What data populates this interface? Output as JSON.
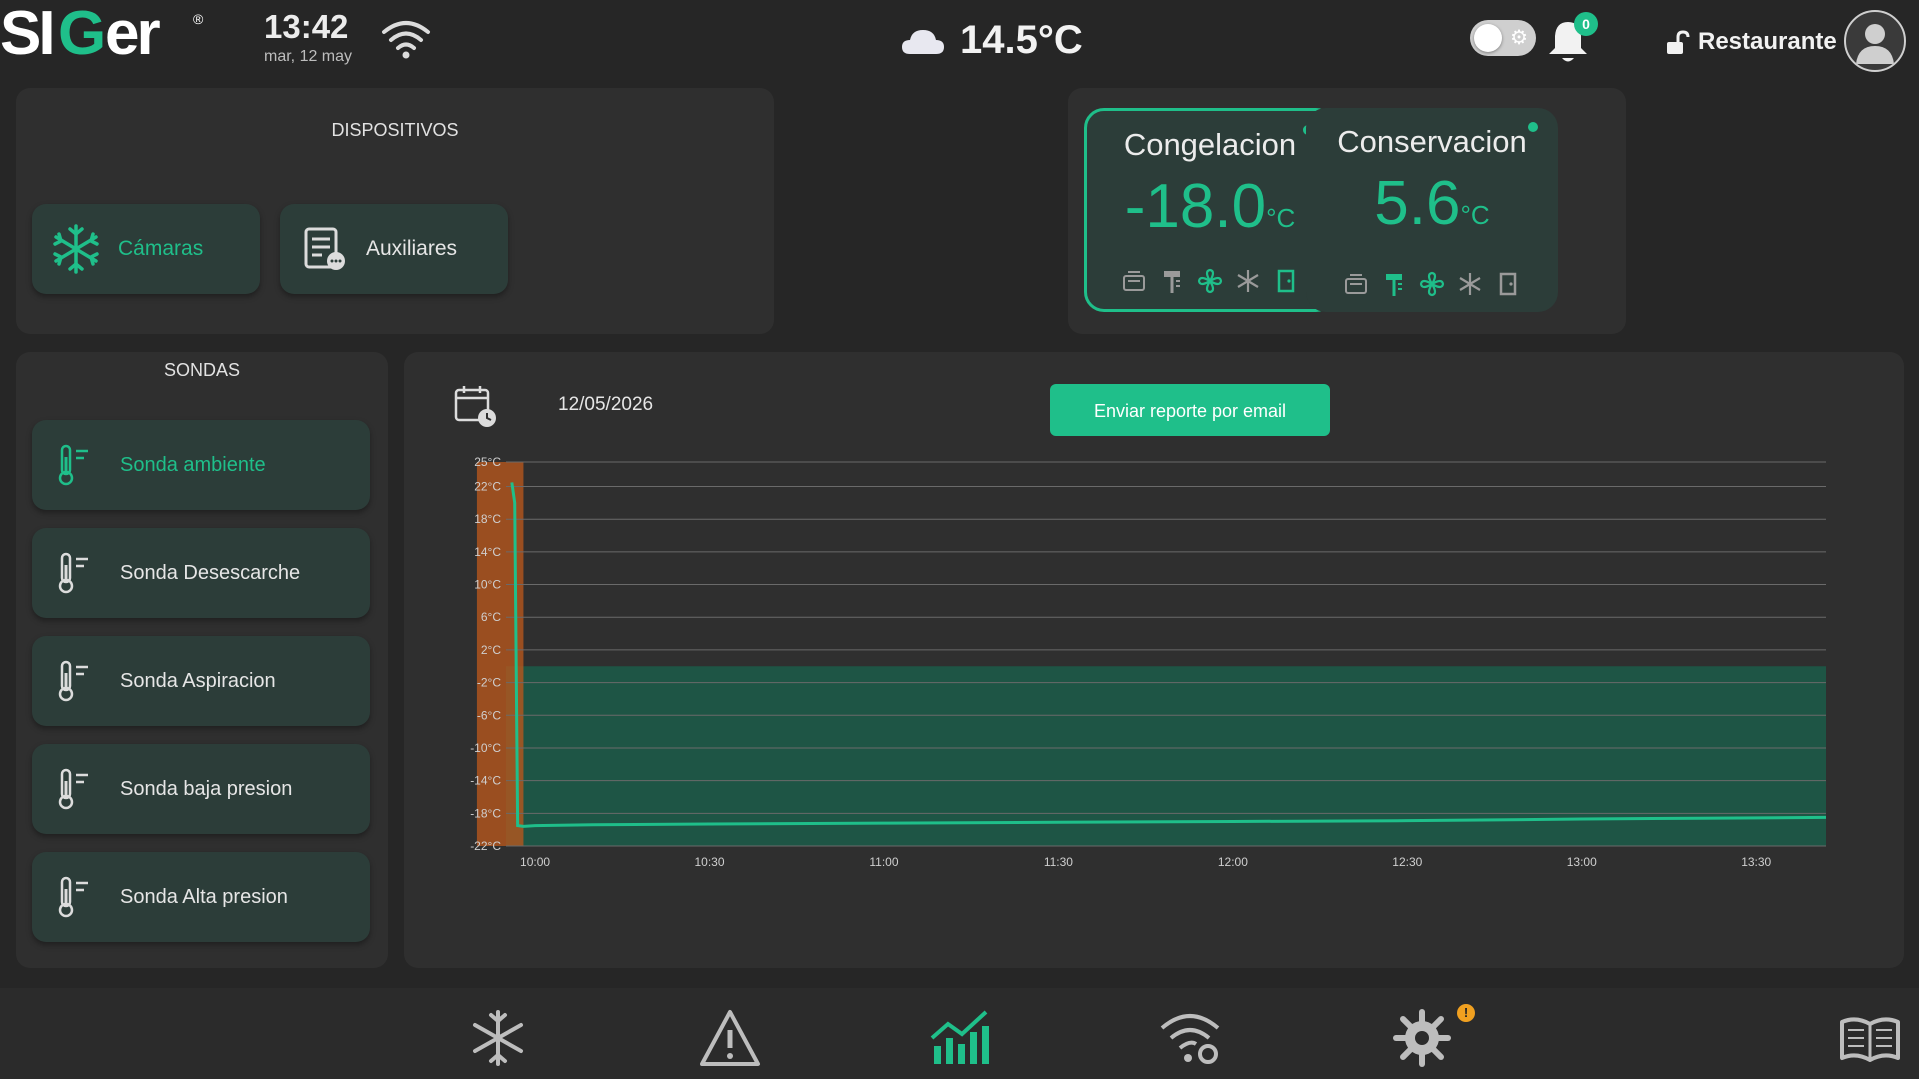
{
  "header": {
    "logo_text": "SIGer",
    "time": "13:42",
    "date": "mar, 12 may",
    "weather_temp": "14.5°C",
    "notification_count": "0",
    "user_name": "Restaurante"
  },
  "devices": {
    "title": "DISPOSITIVOS",
    "buttons": [
      {
        "label": "Cámaras",
        "icon": "snowflake-icon",
        "active": true
      },
      {
        "label": "Auxiliares",
        "icon": "list-icon",
        "active": false
      }
    ]
  },
  "cameras": [
    {
      "name": "Congelacion",
      "temp": "-18.0",
      "unit": "°C",
      "active": true
    },
    {
      "name": "Conservacion",
      "temp": "5.6",
      "unit": "°C",
      "active": false
    }
  ],
  "probes": {
    "title": "SONDAS",
    "items": [
      {
        "label": "Sonda ambiente",
        "active": true
      },
      {
        "label": "Sonda Desescarche",
        "active": false
      },
      {
        "label": "Sonda Aspiracion",
        "active": false
      },
      {
        "label": "Sonda baja presion",
        "active": false
      },
      {
        "label": "Sonda Alta presion",
        "active": false
      }
    ]
  },
  "report": {
    "date": "12/05/2026",
    "email_button": "Enviar reporte por email"
  },
  "colors": {
    "accent": "#1fbf8a",
    "defrost_band": "#b5561d",
    "range_band": "#1d5a48",
    "warning_badge": "#f0a020"
  },
  "chart_data": {
    "type": "line",
    "y_ticks": [
      "25°C",
      "22°C",
      "18°C",
      "14°C",
      "10°C",
      "6°C",
      "2°C",
      "-2°C",
      "-6°C",
      "-10°C",
      "-14°C",
      "-18°C",
      "-22°C"
    ],
    "y_tick_values": [
      25,
      22,
      18,
      14,
      10,
      6,
      2,
      -2,
      -6,
      -10,
      -14,
      -18,
      -22
    ],
    "x_ticks": [
      "10:00",
      "10:30",
      "11:00",
      "11:30",
      "12:00",
      "12:30",
      "13:00",
      "13:30"
    ],
    "ylim": [
      -22,
      25
    ],
    "xlim_minutes": [
      595,
      822
    ],
    "normal_range": [
      -22,
      0
    ],
    "defrost_period_minutes": [
      590,
      598
    ],
    "series": [
      {
        "x_minutes": [
          596,
          596.5,
          597,
          598,
          600,
          610,
          630,
          660,
          690,
          720,
          750,
          780,
          800,
          822
        ],
        "values": [
          22.5,
          20,
          -19.5,
          -19.6,
          -19.5,
          -19.4,
          -19.3,
          -19.2,
          -19.1,
          -19.0,
          -18.9,
          -18.7,
          -18.6,
          -18.5
        ]
      }
    ],
    "grid": true
  }
}
